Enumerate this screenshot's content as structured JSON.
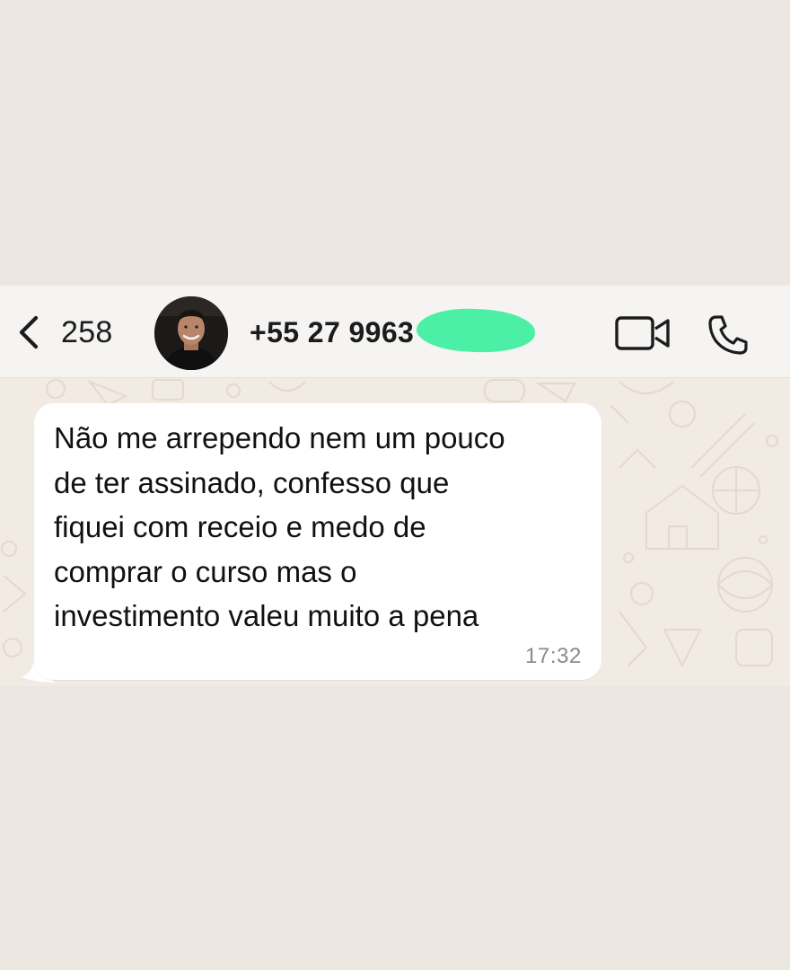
{
  "header": {
    "back_count": "258",
    "contact_name": "+55 27 9963",
    "back_icon": "chevron-left-icon",
    "video_icon": "video-camera-icon",
    "voice_icon": "phone-icon"
  },
  "message": {
    "lines": [
      "Não me arrependo nem um pouco",
      "de ter assinado, confesso que",
      "fiquei com receio e medo de",
      "comprar o curso mas o",
      "investimento valeu muito a pena"
    ],
    "time": "17:32"
  },
  "colors": {
    "page_background": "#ece6e1",
    "header_background": "#f5f4f2",
    "chat_background": "#f1ebe4",
    "bubble": "#ffffff",
    "redaction": "#4cefa6"
  }
}
